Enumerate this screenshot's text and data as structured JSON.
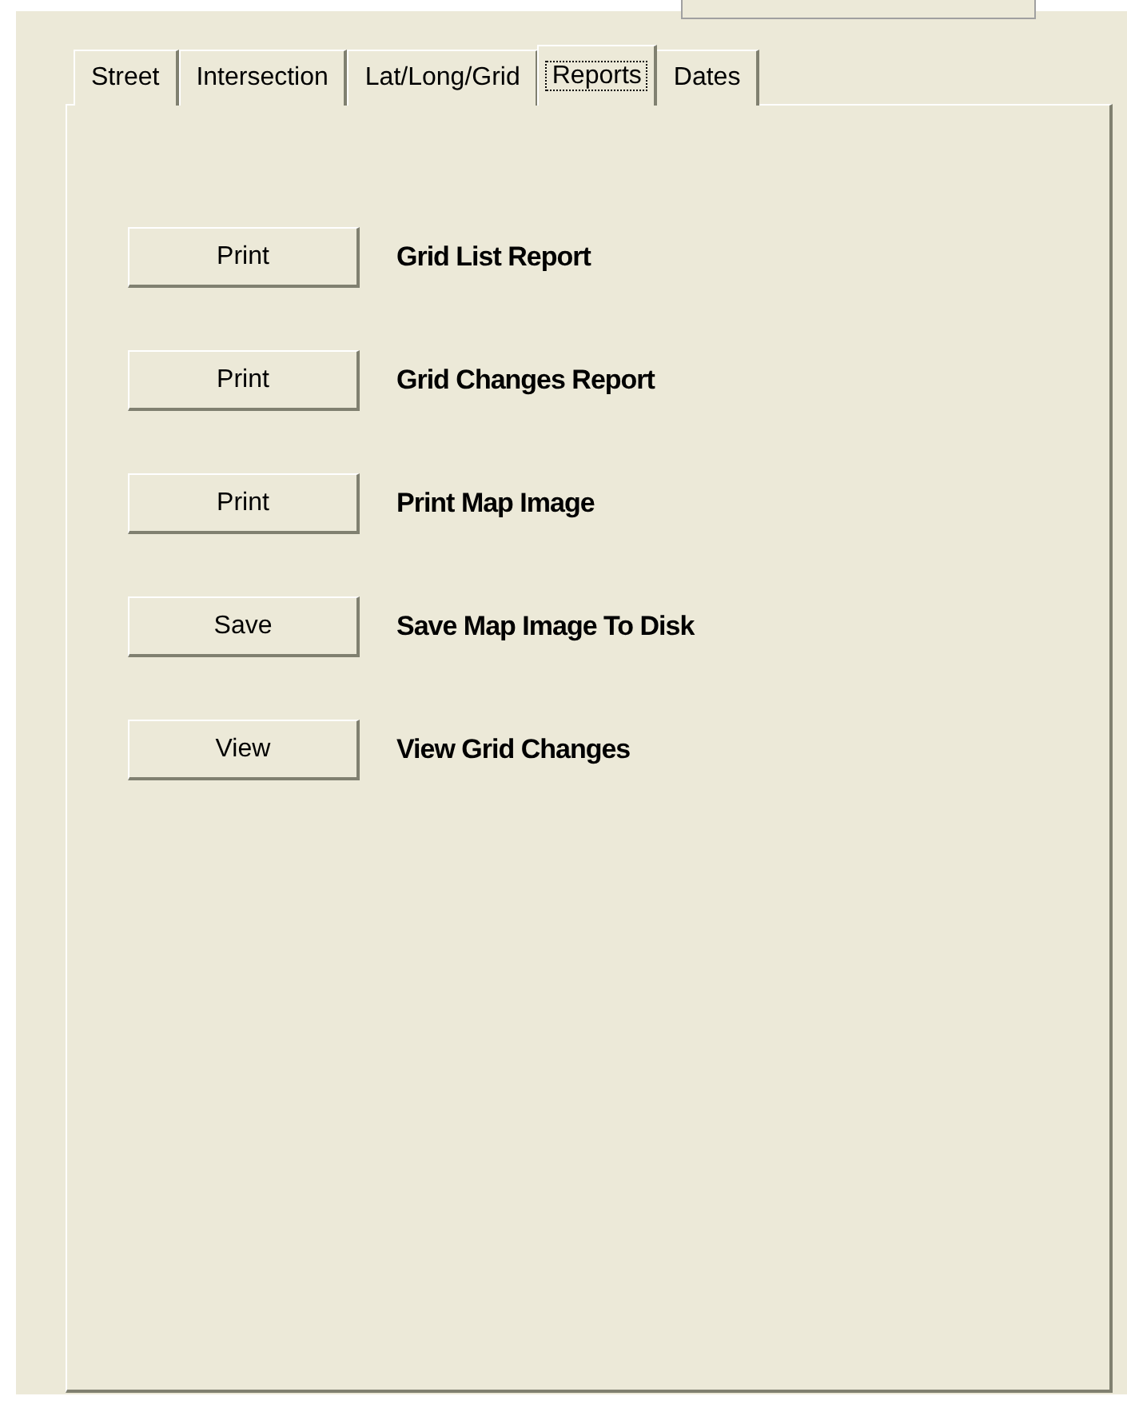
{
  "tabs": [
    {
      "label": "Street",
      "selected": false
    },
    {
      "label": "Intersection",
      "selected": false
    },
    {
      "label": "Lat/Long/Grid",
      "selected": false
    },
    {
      "label": "Reports",
      "selected": true
    },
    {
      "label": "Dates",
      "selected": false
    }
  ],
  "reports": [
    {
      "button": "Print",
      "label": "Grid List Report"
    },
    {
      "button": "Print",
      "label": "Grid Changes Report"
    },
    {
      "button": "Print",
      "label": "Print Map Image"
    },
    {
      "button": "Save",
      "label": "Save Map Image To Disk"
    },
    {
      "button": "View",
      "label": "View Grid Changes"
    }
  ]
}
